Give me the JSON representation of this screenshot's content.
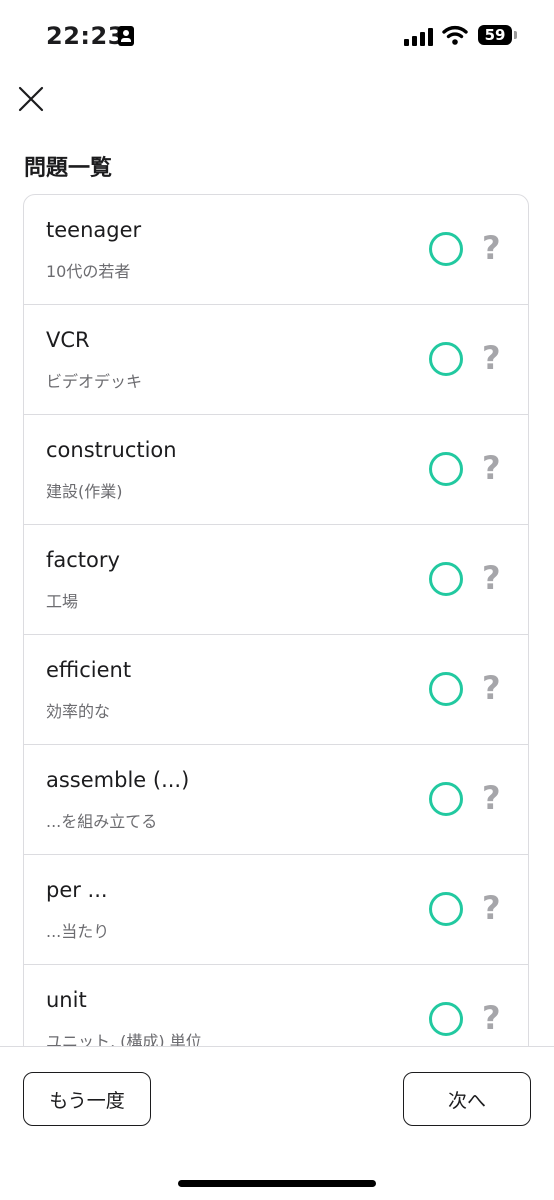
{
  "status_bar": {
    "time": "22:23",
    "battery": "59"
  },
  "header": {
    "title": "問題一覧"
  },
  "items": [
    {
      "word": "teenager",
      "meaning": "10代の若者"
    },
    {
      "word": "VCR",
      "meaning": "ビデオデッキ"
    },
    {
      "word": "construction",
      "meaning": "建設(作業)"
    },
    {
      "word": "factory",
      "meaning": "工場"
    },
    {
      "word": "efficient",
      "meaning": "効率的な"
    },
    {
      "word": "assemble (...)",
      "meaning": "...を組み立てる"
    },
    {
      "word": "per ...",
      "meaning": "...当たり"
    },
    {
      "word": "unit",
      "meaning": "ユニット, (構成) 単位"
    }
  ],
  "qmark": "?",
  "footer": {
    "retry_label": "もう一度",
    "next_label": "次へ"
  },
  "colors": {
    "correct": "#22c9a0",
    "muted": "#a6a6aa"
  }
}
